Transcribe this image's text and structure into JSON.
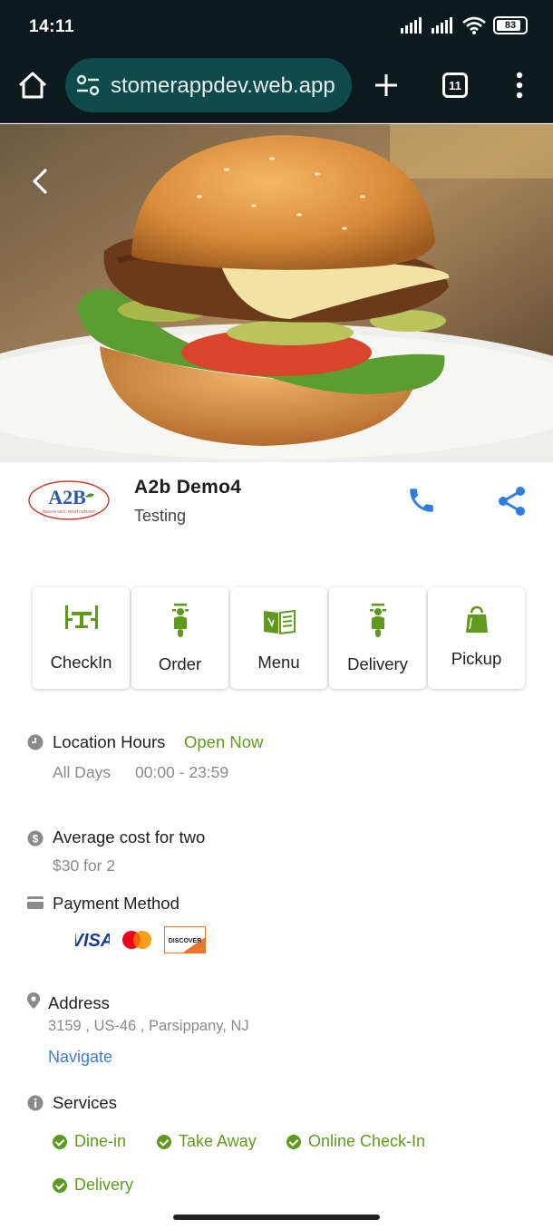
{
  "status_bar": {
    "time": "14:11",
    "battery": "83"
  },
  "browser": {
    "url": "stomerappdev.web.app",
    "tab_count": "11"
  },
  "restaurant": {
    "name": "A2b Demo4",
    "subtitle": "Testing",
    "logo_text": "A2B",
    "logo_tagline": "INDIAN VEG. RESTAURANT"
  },
  "actions": [
    {
      "label": "CheckIn",
      "icon": "table-chairs-icon"
    },
    {
      "label": "Order",
      "icon": "scooter-icon"
    },
    {
      "label": "Menu",
      "icon": "menu-book-icon"
    },
    {
      "label": "Delivery",
      "icon": "scooter-icon"
    },
    {
      "label": "Pickup",
      "icon": "bag-icon"
    }
  ],
  "location_hours": {
    "label": "Location Hours",
    "status": "Open Now",
    "days": "All Days",
    "hours": "00:00 - 23:59"
  },
  "average_cost": {
    "label": "Average cost for two",
    "value": "$30 for 2"
  },
  "payment": {
    "label": "Payment Method",
    "cards": [
      "VISA",
      "Mastercard",
      "DISCOVER"
    ]
  },
  "address": {
    "label": "Address",
    "value": "3159 , US-46 , Parsippany, NJ",
    "navigate": "Navigate"
  },
  "services": {
    "label": "Services",
    "items": [
      "Dine-in",
      "Take Away",
      "Online Check-In",
      "Delivery"
    ]
  },
  "colors": {
    "accent_green": "#5f9a1f",
    "link_blue": "#3d7fd6",
    "icon_blue": "#2f7de1",
    "browser_bg": "#0d1a1d"
  }
}
